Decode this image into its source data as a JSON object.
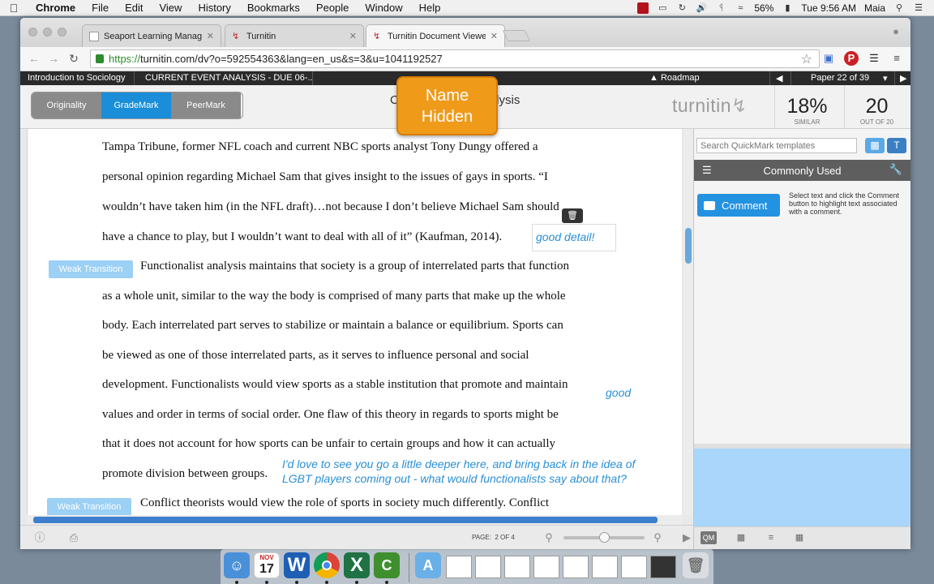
{
  "menubar": {
    "app": "Chrome",
    "menus": [
      "File",
      "Edit",
      "View",
      "History",
      "Bookmarks",
      "People",
      "Window",
      "Help"
    ],
    "battery": "56%",
    "clock": "Tue 9:56 AM",
    "user": "Maia"
  },
  "browser": {
    "tabs": [
      {
        "title": "Seaport Learning Managem",
        "active": false
      },
      {
        "title": "Turnitin",
        "active": false
      },
      {
        "title": "Turnitin Document Viewer",
        "active": true
      }
    ],
    "url_scheme": "https://",
    "url_rest": "turnitin.com/dv?o=592554363&lang=en_us&s=3&u=1041192527"
  },
  "viewer": {
    "course": "Introduction to Sociology",
    "assignment": "CURRENT EVENT ANALYSIS - DUE 06-..",
    "roadmap": "Roadmap",
    "paper_position": "Paper 22 of 39",
    "modes": [
      "Originality",
      "GradeMark",
      "PeerMark"
    ],
    "title_left": "C",
    "title_right": "alysis",
    "name_overlay": "Name Hidden",
    "logo": "turnitin",
    "similarity": {
      "value": "18%",
      "label": "SIMILAR"
    },
    "grade": {
      "value": "20",
      "label": "OUT OF 20"
    }
  },
  "document": {
    "lines": [
      "Tampa Tribune, former NFL coach and current NBC sports analyst Tony Dungy offered a",
      "personal opinion regarding Michael Sam that gives insight to the issues of gays in sports.  “I",
      "wouldn’t have taken him (in the NFL draft)…not because I don’t believe Michael Sam should",
      "have a chance to play, but I wouldn’t want to deal with all of it” (Kaufman, 2014).",
      "Functionalist analysis maintains that society is a group of interrelated parts that function",
      "as a whole unit, similar to the way the body is comprised of many parts that make up the whole",
      "body.  Each interrelated part serves to stabilize or maintain a balance or equilibrium.  Sports can",
      "be viewed as one of those interrelated parts, as it serves to influence personal and social",
      "development.  Functionalists would view sports as a stable institution that promote and maintain",
      "values and order in terms of social order.  One flaw of this theory in regards to sports might be",
      "that it does not account for how sports can be unfair to certain groups and how it can actually",
      "promote division between groups.",
      "Conflict theorists would view the role of sports in society much differently.  Conflict"
    ],
    "tags": [
      "Weak Transition",
      "Weak Transition"
    ],
    "comments": [
      "good detail!",
      "good",
      "I'd love to see you go a little deeper here, and bring back in the idea of",
      "LGBT players coming out - what would functionalists say about that?"
    ],
    "page_label": "PAGE:",
    "page_value": "2 OF 4"
  },
  "quickmark": {
    "search_placeholder": "Search QuickMark templates",
    "set_name": "Commonly Used",
    "comment_button": "Comment",
    "hint": "Select text and click the Comment button to highlight text associated with a comment.",
    "qm_label": "QM"
  },
  "dock": {
    "calendar_month": "NOV",
    "calendar_day": "17"
  }
}
